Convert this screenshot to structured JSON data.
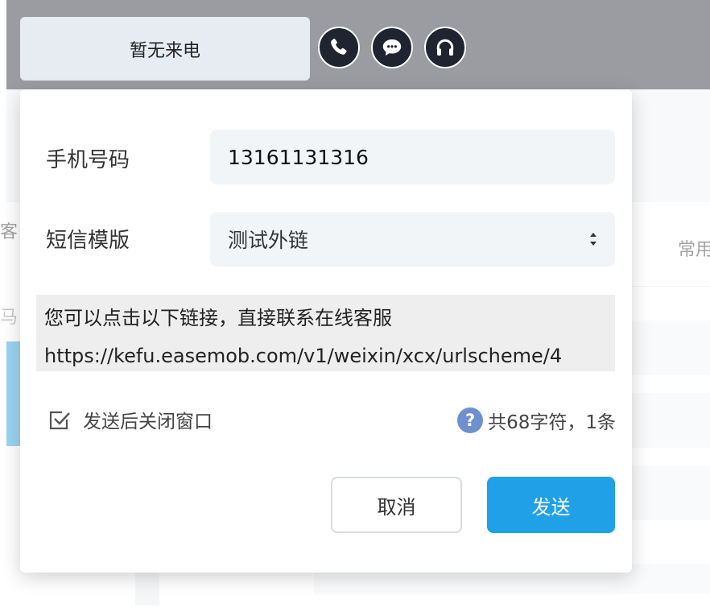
{
  "topbar": {
    "status": "暂无来电",
    "icons": [
      "phone-icon",
      "chat-icon",
      "headset-icon"
    ]
  },
  "background": {
    "left_fragment_1": "客",
    "left_fragment_2": "马",
    "right_fragment": "常用"
  },
  "dialog": {
    "phone_label": "手机号码",
    "phone_value": "13161131316",
    "template_label": "短信模版",
    "template_value": "测试外链",
    "message": {
      "line1": "您可以点击以下链接，直接联系在线客服",
      "line2": "https://kefu.easemob.com/v1/weixin/xcx/urlscheme/4"
    },
    "close_after_send_label": "发送后关闭窗口",
    "close_after_send_checked": true,
    "char_count_text": "共68字符，1条",
    "cancel_label": "取消",
    "send_label": "发送"
  },
  "colors": {
    "topbar_bg": "#1f2430",
    "accent": "#20a0e6",
    "help_icon": "#6f8fce"
  }
}
